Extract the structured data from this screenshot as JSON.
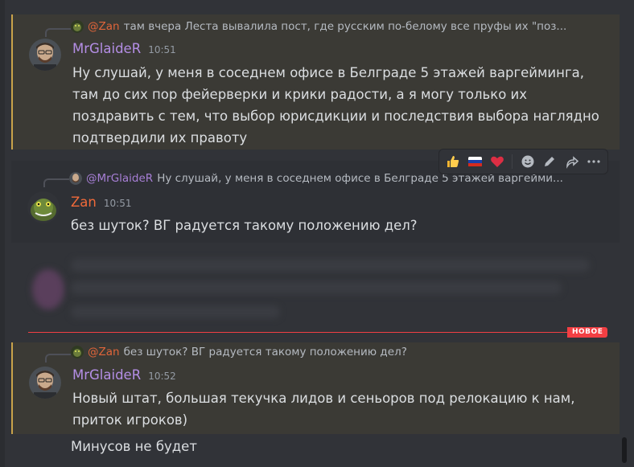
{
  "messages": [
    {
      "reply": {
        "author": "@Zan",
        "text": "там вчера Леста вывалила пост, где русским по-белому все пруфы их \"поз..."
      },
      "author": "MrGlaideR",
      "time": "10:51",
      "lines": [
        "Ну слушай, у меня в соседнем офисе в Белграде 5 этажей варгейминга,",
        "там до сих пор фейерверки и крики радости, а я могу только их",
        "поздравить с тем, что выбор юрисдикции и последствия выбора наглядно",
        "подтвердили их правоту"
      ]
    },
    {
      "reply": {
        "author": "@MrGlaideR",
        "text": "Ну слушай, у меня в соседнем офисе в Белграде 5 этажей варгейми..."
      },
      "author": "Zan",
      "time": "10:51",
      "lines": [
        "без шуток? ВГ радуется такому положению дел?"
      ]
    },
    {
      "reply": {
        "author": "@Zan",
        "text": "без шуток? ВГ радуется такому положению дел?"
      },
      "author": "MrGlaideR",
      "time": "10:52",
      "lines": [
        "Новый штат, большая текучка лидов и сеньоров под релокацию к нам,",
        "приток игроков)"
      ],
      "followup": "Минусов не будет"
    }
  ],
  "divider": {
    "label": "НОВОЕ"
  },
  "toolbar": {
    "reactions": [
      "thumbs-up",
      "russian-flag",
      "red-heart"
    ],
    "actions": [
      "add-reaction-icon",
      "edit-icon",
      "forward-icon",
      "more-icon"
    ]
  },
  "colors": {
    "background": "#313338",
    "highlight": "#3b3a35",
    "mention_bar": "#c9a34a",
    "new_divider": "#f23f43"
  }
}
